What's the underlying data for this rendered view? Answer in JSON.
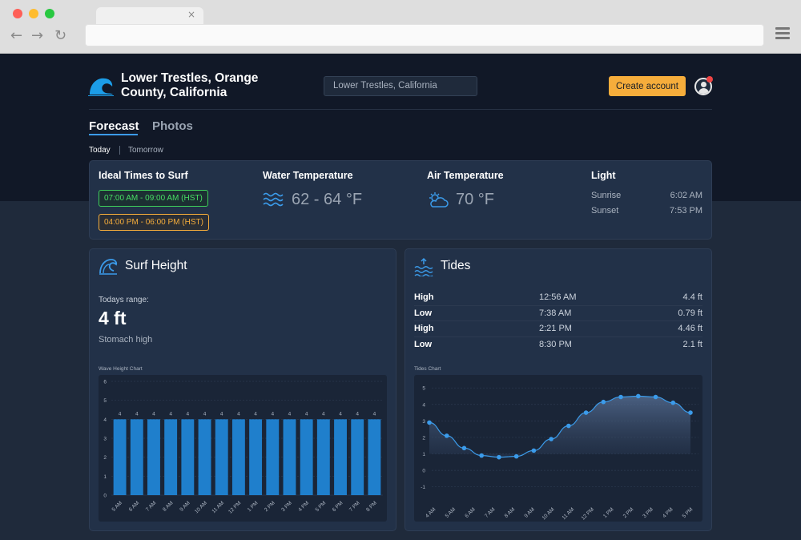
{
  "browser": {
    "tab_close": "×",
    "back_icon": "arrow-left-icon",
    "forward_icon": "arrow-right-icon",
    "reload_icon": "reload-icon",
    "menu_icon": "hamburger-menu-icon"
  },
  "header": {
    "site_title_line1": "Lower Trestles, Orange",
    "site_title_line2": "County, California",
    "search_value": "Lower Trestles, California",
    "create_account_label": "Create account",
    "accent_color": "#f6ad3b",
    "brand_color": "#1c9de8"
  },
  "nav": {
    "tabs": [
      {
        "label": "Forecast",
        "active": true
      },
      {
        "label": "Photos",
        "active": false
      }
    ],
    "days": [
      {
        "label": "Today",
        "active": true
      },
      {
        "label": "Tomorrow",
        "active": false
      }
    ]
  },
  "info": {
    "ideal_times": {
      "heading": "Ideal Times to Surf",
      "slots": [
        "07:00 AM - 09:00 AM (HST)",
        "04:00 PM - 06:00 PM (HST)"
      ]
    },
    "water": {
      "heading": "Water Temperature",
      "value": "62 - 64 °F",
      "icon": "waves-icon"
    },
    "air": {
      "heading": "Air Temperature",
      "value": "70 °F",
      "icon": "partly-cloudy-icon"
    },
    "light": {
      "heading": "Light",
      "rows": [
        {
          "label": "Sunrise",
          "value": "6:02 AM"
        },
        {
          "label": "Sunset",
          "value": "7:53 PM"
        }
      ]
    }
  },
  "surf": {
    "title": "Surf Height",
    "icon": "wave-icon",
    "range_label": "Todays range:",
    "range_value": "4 ft",
    "range_desc": "Stomach high",
    "chart_caption": "Wave Height Chart"
  },
  "tides": {
    "title": "Tides",
    "icon": "tide-icon",
    "rows": [
      {
        "type": "High",
        "time": "12:56 AM",
        "height": "4.4 ft"
      },
      {
        "type": "Low",
        "time": "7:38 AM",
        "height": "0.79 ft"
      },
      {
        "type": "High",
        "time": "2:21 PM",
        "height": "4.46 ft"
      },
      {
        "type": "Low",
        "time": "8:30 PM",
        "height": "2.1 ft"
      }
    ],
    "chart_caption": "Tides Chart"
  },
  "chart_data": [
    {
      "type": "bar",
      "title": "Wave Height Chart",
      "categories": [
        "5 AM",
        "6 AM",
        "7 AM",
        "8 AM",
        "9 AM",
        "10 AM",
        "11 AM",
        "12 PM",
        "1 PM",
        "2 PM",
        "3 PM",
        "4 PM",
        "5 PM",
        "6 PM",
        "7 PM",
        "8 PM"
      ],
      "values": [
        4,
        4,
        4,
        4,
        4,
        4,
        4,
        4,
        4,
        4,
        4,
        4,
        4,
        4,
        4,
        4
      ],
      "yticks": [
        0,
        1,
        2,
        3,
        4,
        5,
        6
      ],
      "ylim": [
        0,
        6
      ],
      "color": "#1f7fcc",
      "data_labels": true,
      "grid": true
    },
    {
      "type": "area",
      "title": "Tides Chart",
      "categories": [
        "4 AM",
        "5 AM",
        "6 AM",
        "7 AM",
        "8 AM",
        "9 AM",
        "10 AM",
        "11 AM",
        "12 PM",
        "1 PM",
        "2 PM",
        "3 PM",
        "4 PM",
        "5 PM"
      ],
      "values": [
        2.9,
        2.1,
        1.35,
        0.9,
        0.8,
        0.85,
        1.2,
        1.9,
        2.7,
        3.5,
        4.15,
        4.45,
        4.5,
        4.45,
        4.1,
        3.5
      ],
      "yticks": [
        -1,
        0,
        1,
        2,
        3,
        4,
        5
      ],
      "ylim": [
        -1.5,
        5.3
      ],
      "color": "#3b9bea",
      "grid": true
    }
  ]
}
